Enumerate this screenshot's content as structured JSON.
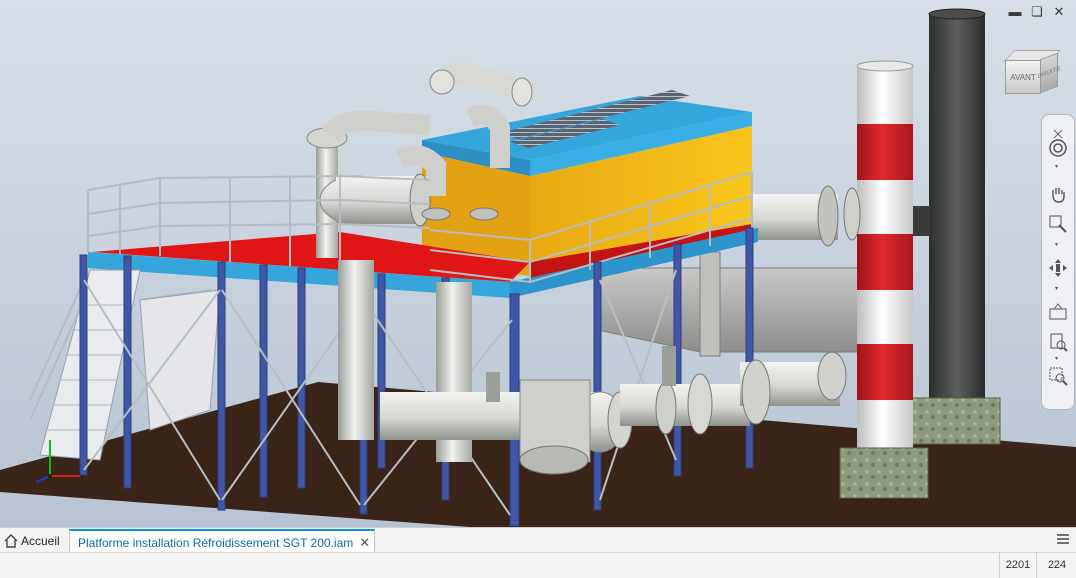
{
  "window": {
    "controls": [
      "minimize",
      "restore",
      "close"
    ]
  },
  "viewcube": {
    "front_label": "AVANT",
    "side_label": "DROITE"
  },
  "navigation_bar": {
    "tools": [
      "steering-wheel",
      "pan",
      "zoom",
      "orbit",
      "look-at",
      "zoom-all",
      "zoom-window"
    ]
  },
  "model": {
    "description_colors": {
      "frame": "#3f57a6",
      "deck": "#e01515",
      "deck_beam": "#35a6dc",
      "enclosure": "#f7c41a",
      "pipe": "#d9dbd8",
      "ground": "#3a2418",
      "chimney_band_red": "#d21f26",
      "chimney_band_white": "#f2f2f2",
      "stack": "#3b3d3d",
      "foundation": "#8a977a"
    }
  },
  "tabs": {
    "home_label": "Accueil",
    "document_label": "Platforme installation Réfroidissement SGT 200.iam"
  },
  "statusbar": {
    "value_a": "2201",
    "value_b": "224"
  }
}
